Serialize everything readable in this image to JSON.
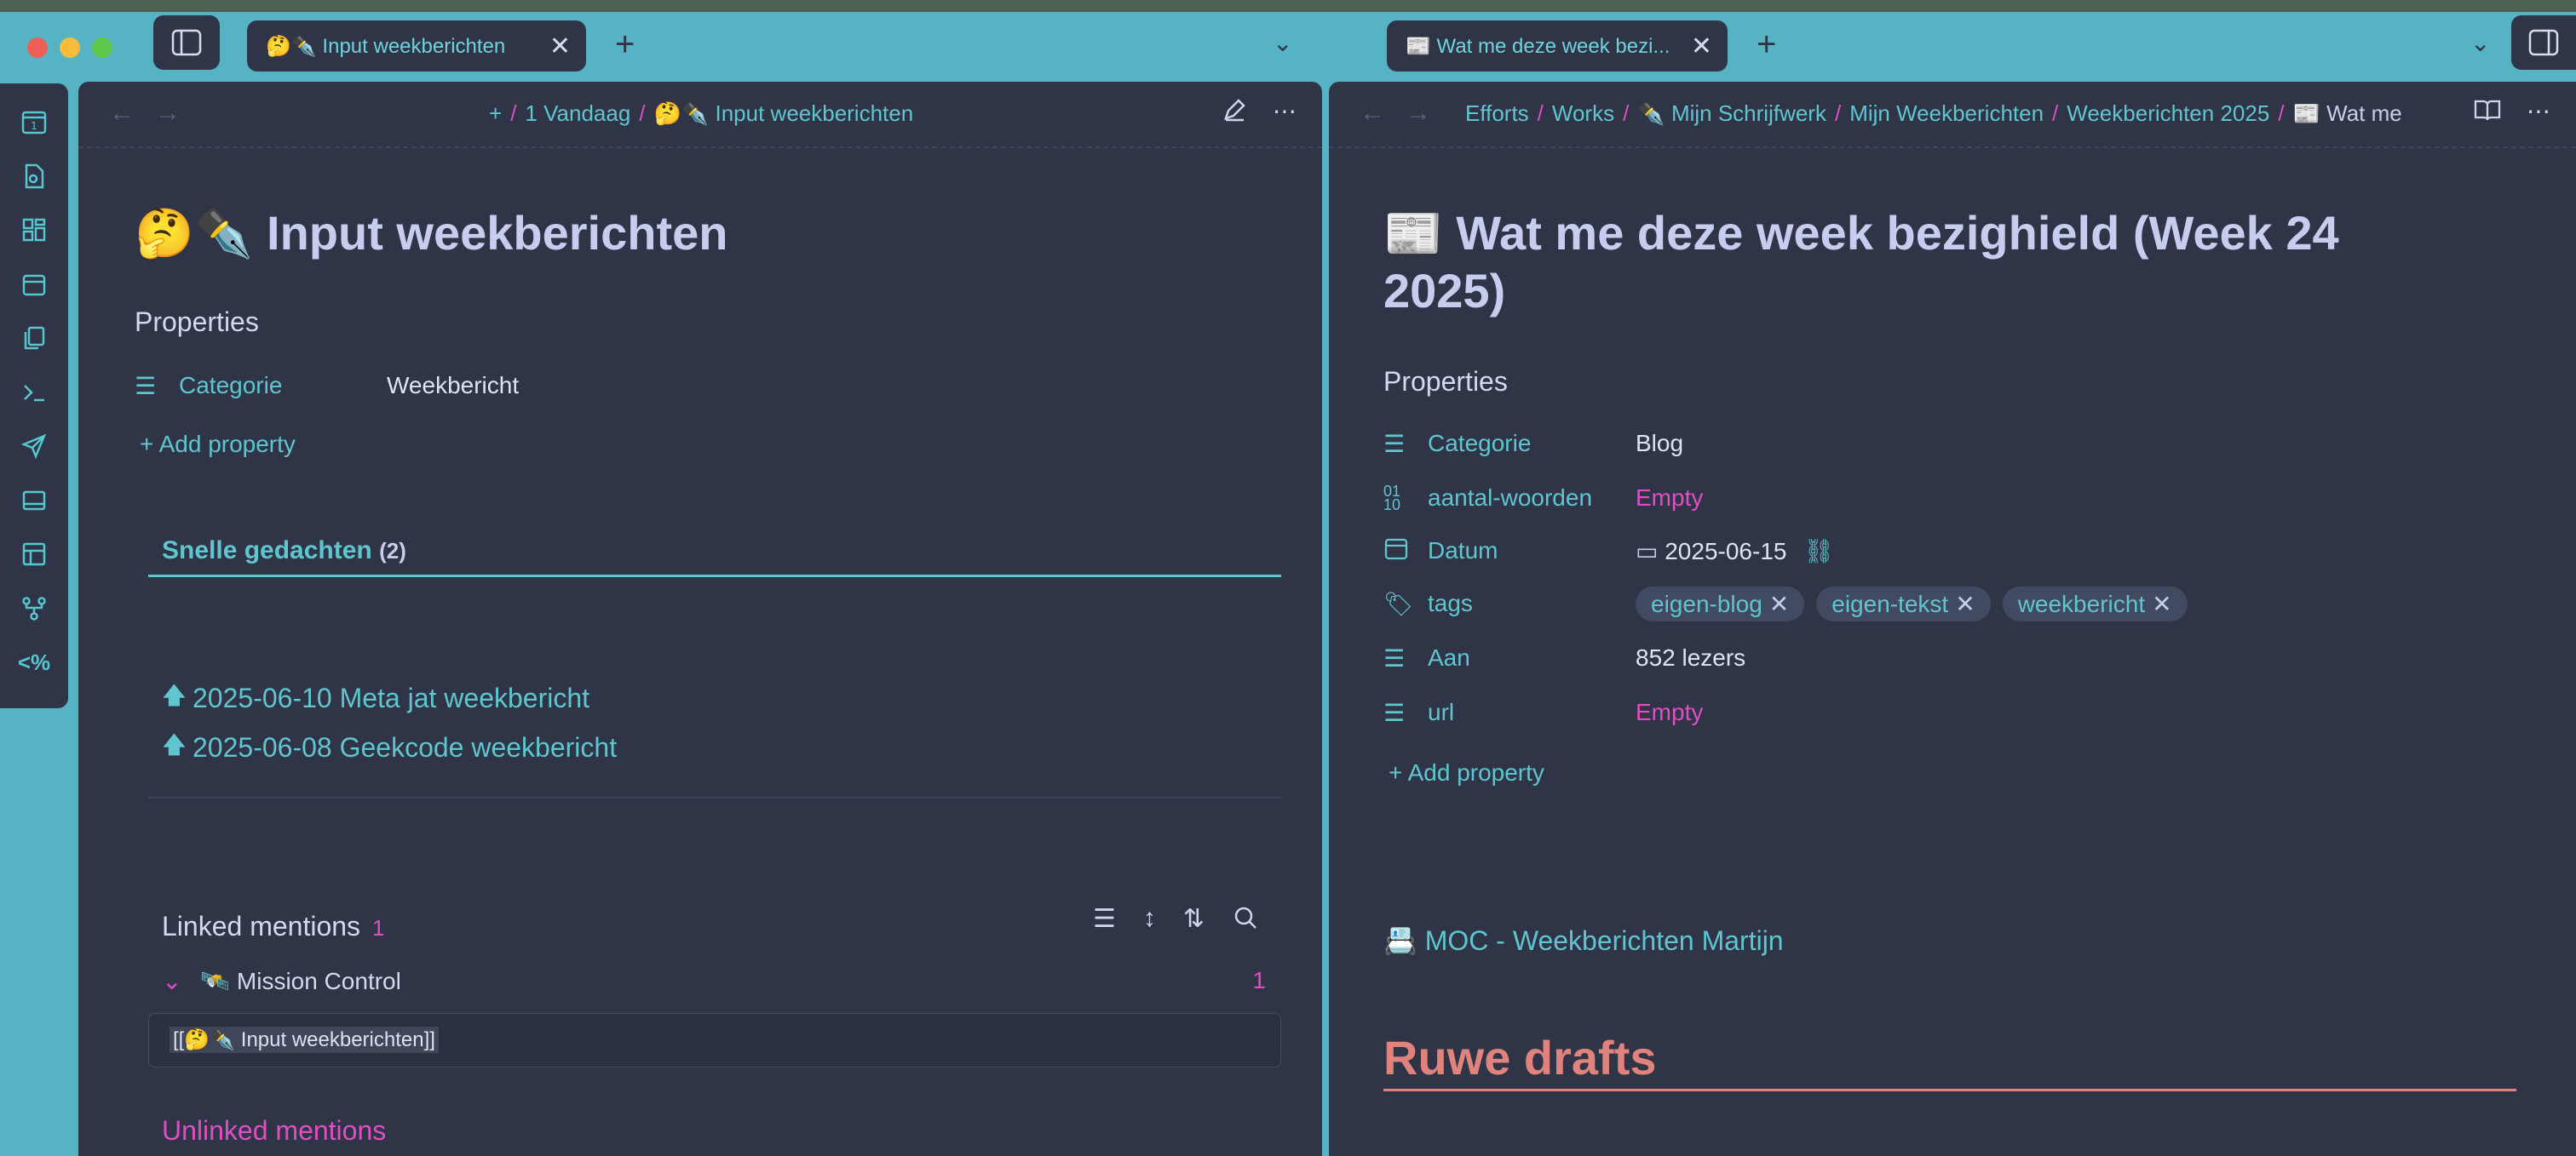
{
  "window": {
    "tabs": [
      {
        "label": "🤔✒️ Input weekberichten",
        "close": "✕"
      },
      {
        "label": "📰 Wat me deze week bezi...",
        "close": "✕"
      }
    ],
    "new_tab": "+"
  },
  "left": {
    "breadcrumbs": [
      "+",
      "1 Vandaag",
      "🤔✒️ Input weekberichten"
    ],
    "title": "🤔✒️ Input weekberichten",
    "properties_title": "Properties",
    "properties": [
      {
        "key": "Categorie",
        "value": "Weekbericht"
      }
    ],
    "add_property": "Add property",
    "snelle": {
      "title": "Snelle gedachten",
      "count": "(2)",
      "items": [
        "2025-06-10 Meta jat weekbericht",
        "2025-06-08 Geekcode weekbericht"
      ]
    },
    "linked_mentions": {
      "title": "Linked mentions",
      "count": "1",
      "group": "🛰️ Mission Control",
      "group_count": "1",
      "snippet": "[[🤔✒️ Input weekberichten]]"
    },
    "unlinked_mentions": "Unlinked mentions"
  },
  "right": {
    "breadcrumbs": [
      "Efforts",
      "Works",
      "✒️ Mijn Schrijfwerk",
      "Mijn Weekberichten",
      "Weekberichten 2025",
      "📰 Wat me"
    ],
    "title_line1": "📰 Wat me deze week bezighield (Week 24",
    "title_line2": "2025)",
    "properties_title": "Properties",
    "properties": {
      "categorie_key": "Categorie",
      "categorie_val": "Blog",
      "woorden_key": "aantal-woorden",
      "woorden_val": "Empty",
      "datum_key": "Datum",
      "datum_val": "2025-06-15",
      "tags_key": "tags",
      "tags": [
        "eigen-blog",
        "eigen-tekst",
        "weekbericht"
      ],
      "aan_key": "Aan",
      "aan_val": "852 lezers",
      "url_key": "url",
      "url_val": "Empty"
    },
    "add_property": "Add property",
    "moc_link": "📇 MOC - Weekberichten Martijn",
    "heading": "Ruwe drafts"
  },
  "colors": {
    "accent": "#5fc6d0",
    "pink": "#e04ec4",
    "salmon": "#e0837d",
    "pane": "#2f3446",
    "frame": "#56b3c3"
  },
  "icons": [
    "sidebar-icon",
    "calendar-icon",
    "file-search-icon",
    "grid-icon",
    "copy-icon",
    "terminal-icon",
    "send-icon",
    "layout-icon",
    "template-icon",
    "graph-icon",
    "percent-code-icon"
  ]
}
